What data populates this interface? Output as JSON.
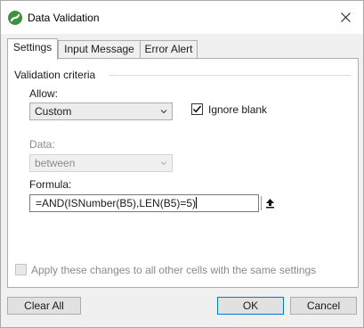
{
  "window": {
    "title": "Data Validation",
    "brand_color": "#3f9142"
  },
  "tabs": [
    {
      "label": "Settings",
      "active": true
    },
    {
      "label": "Input Message",
      "active": false
    },
    {
      "label": "Error Alert",
      "active": false
    }
  ],
  "settings": {
    "group_label": "Validation criteria",
    "allow_label": "Allow:",
    "allow_value": "Custom",
    "ignore_blank_label": "Ignore blank",
    "ignore_blank_checked": true,
    "data_label": "Data:",
    "data_value": "between",
    "formula_label": "Formula:",
    "formula_value": "=AND(ISNumber(B5),LEN(B5)=5)",
    "apply_all_label": "Apply these changes to all other cells with the same settings",
    "apply_all_checked": false
  },
  "buttons": {
    "clear_all": "Clear All",
    "ok": "OK",
    "cancel": "Cancel"
  }
}
